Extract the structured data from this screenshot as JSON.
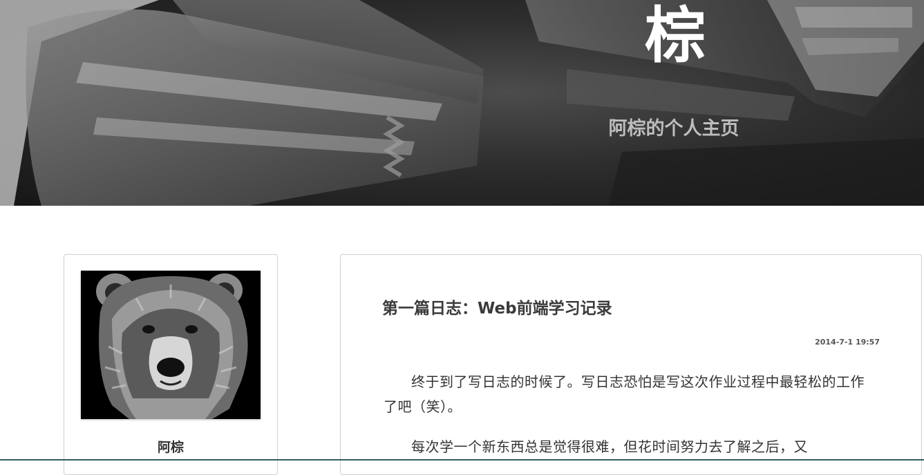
{
  "header": {
    "title": "棕",
    "subtitle": "阿棕的个人主页"
  },
  "profile": {
    "avatar_icon": "bear-portrait",
    "name": "阿棕"
  },
  "post": {
    "title": "第一篇日志：Web前端学习记录",
    "date": "2014-7-1 19:57",
    "paragraphs": [
      "终于到了写日志的时候了。写日志恐怕是写这次作业过程中最轻松的工作了吧（笑）。",
      "每次学一个新东西总是觉得很难，但花时间努力去了解之后，又"
    ]
  },
  "colors": {
    "banner_dark": "#1a1a1a",
    "card_border": "#cfcfcf",
    "text": "#333333",
    "bottom_rule": "#2f5f5a"
  }
}
